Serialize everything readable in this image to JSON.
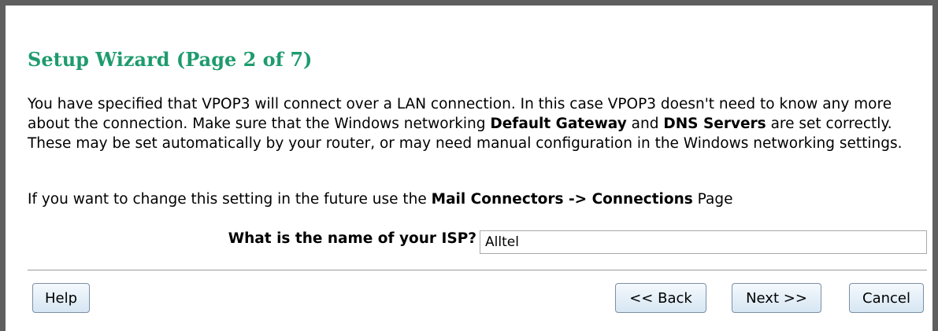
{
  "wizard": {
    "title": "Setup Wizard (Page 2 of 7)",
    "paragraph1": {
      "part1": "You have specified that VPOP3 will connect over a LAN connection. In this case VPOP3 doesn't need to know any more about the connection. Make sure that the Windows networking ",
      "bold1": "Default Gateway",
      "part2": " and ",
      "bold2": "DNS Servers",
      "part3": " are set correctly. These may be set automatically by your router, or may need manual configuration in the Windows networking settings."
    },
    "paragraph2": {
      "part1": "If you want to change this setting in the future use the ",
      "bold1": "Mail Connectors -> Connections",
      "part2": " Page"
    },
    "isp": {
      "label": "What is the name of your ISP?",
      "value": "Alltel"
    },
    "buttons": {
      "help": "Help",
      "back": "<< Back",
      "next": "Next >>",
      "cancel": "Cancel"
    }
  },
  "colors": {
    "title": "#1e9b6e",
    "frame": "#5f5f5f",
    "button_border": "#7c8fa5"
  }
}
